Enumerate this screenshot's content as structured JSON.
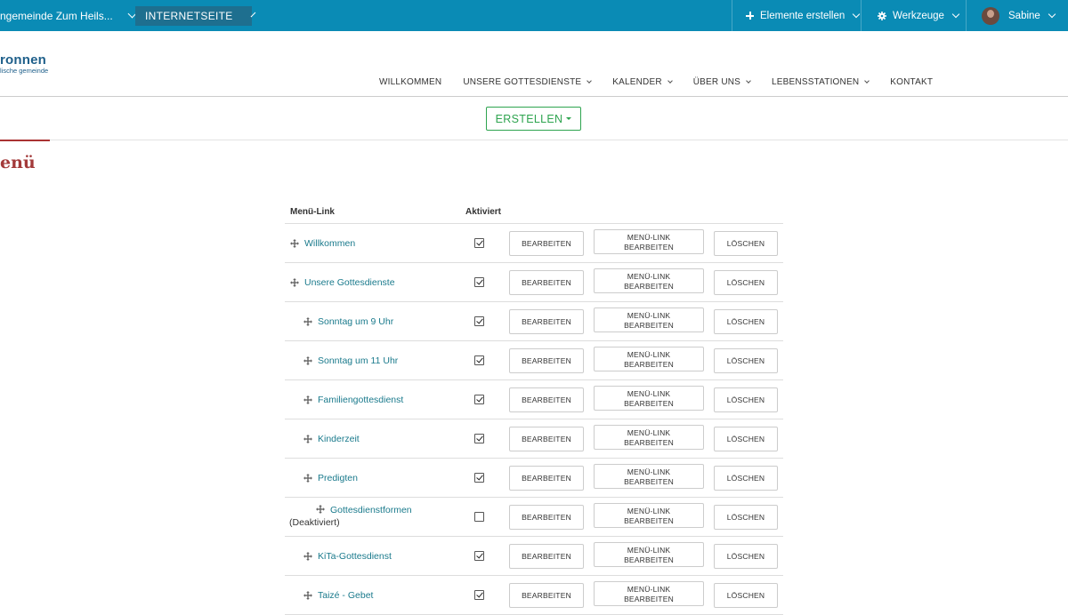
{
  "topbar": {
    "site_name": "ngemeinde Zum Heils...",
    "mode": "INTERNETSEITE",
    "create_elements": "Elemente erstellen",
    "tools": "Werkzeuge",
    "user": "Sabine"
  },
  "logo": {
    "line1": "ronnen",
    "line2": "lische gemeinde"
  },
  "nav": {
    "items": [
      "WILLKOMMEN",
      "UNSERE GOTTESDIENSTE",
      "KALENDER",
      "ÜBER UNS",
      "LEBENSSTATIONEN",
      "KONTAKT"
    ]
  },
  "create_button": "ERSTELLEN",
  "page_title": "enü",
  "table": {
    "headers": {
      "link": "Menü-Link",
      "active": "Aktiviert"
    },
    "buttons": {
      "edit": "BEARBEITEN",
      "menu_line1": "MENÜ-LINK",
      "menu_line2": "BEARBEITEN",
      "delete": "LÖSCHEN"
    },
    "rows": [
      {
        "label": "Willkommen",
        "level": 0,
        "active": true,
        "note": ""
      },
      {
        "label": "Unsere Gottesdienste",
        "level": 0,
        "active": true,
        "note": ""
      },
      {
        "label": "Sonntag um 9 Uhr",
        "level": 1,
        "active": true,
        "note": ""
      },
      {
        "label": "Sonntag um 11 Uhr",
        "level": 1,
        "active": true,
        "note": ""
      },
      {
        "label": "Familiengottesdienst",
        "level": 1,
        "active": true,
        "note": ""
      },
      {
        "label": "Kinderzeit",
        "level": 1,
        "active": true,
        "note": ""
      },
      {
        "label": "Predigten",
        "level": 1,
        "active": true,
        "note": ""
      },
      {
        "label": "Gottesdienstformen",
        "level": 2,
        "active": false,
        "note": "(Deaktiviert)"
      },
      {
        "label": "KiTa-Gottesdienst",
        "level": 1,
        "active": true,
        "note": ""
      },
      {
        "label": "Taizé - Gebet",
        "level": 1,
        "active": true,
        "note": ""
      }
    ]
  },
  "colors": {
    "topbar": "#0a8bb5",
    "link": "#1a7a8c",
    "accent_red": "#a33a3a",
    "create_green": "#2ea44f"
  }
}
